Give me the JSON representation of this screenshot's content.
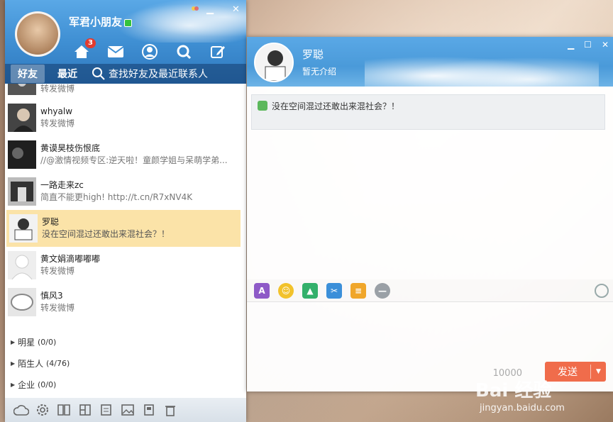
{
  "user": {
    "nickname": "军君小朋友"
  },
  "header": {
    "badge_count": "3"
  },
  "tabs": [
    {
      "label": "好友"
    },
    {
      "label": "最近"
    }
  ],
  "search": {
    "placeholder": "查找好友及最近联系人"
  },
  "contacts": [
    {
      "name": "",
      "msg": "转发微博"
    },
    {
      "name": "whyalw",
      "msg": "转发微博"
    },
    {
      "name": "黄谟昊枝伤恨底",
      "msg": "//@激情视频专区:逆天啦！童颜学姐与呆萌学弟..."
    },
    {
      "name": "一路走来zc",
      "msg": "简直不能更high! http://t.cn/R7xNV4K"
    },
    {
      "name": "罗聪",
      "msg": "没在空间混过还敢出来混社会？！"
    },
    {
      "name": "黄文娟滴嘟嘟嘟",
      "msg": "转发微博"
    },
    {
      "name": "慎风3",
      "msg": "转发微博"
    }
  ],
  "groups": [
    {
      "label": "明星",
      "count": "(0/0)"
    },
    {
      "label": "陌生人",
      "count": "(4/76)"
    },
    {
      "label": "企业",
      "count": "(0/0)"
    }
  ],
  "chat": {
    "name": "罗聪",
    "signature": "暂无介绍",
    "status": "没在空间混过还敢出来混社会？！",
    "counter": "10000",
    "send_label": "发送"
  },
  "watermark": {
    "logo": "Bai 经验",
    "url": "jingyan.baidu.com"
  },
  "colors": {
    "accent": "#3f8fd3",
    "send": "#f06c4b",
    "selected": "#fbe3a8"
  }
}
